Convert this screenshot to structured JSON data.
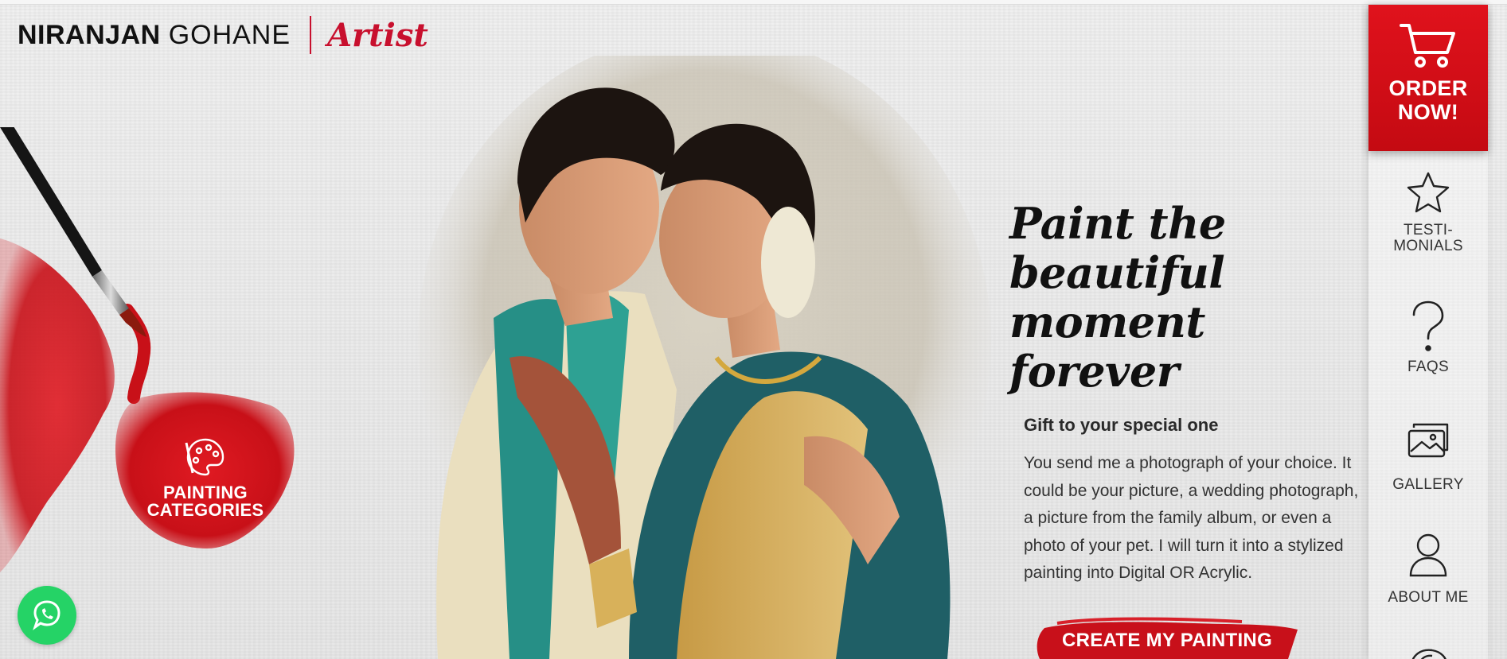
{
  "brand": {
    "first_name": "NIRANJAN",
    "last_name": "GOHANE",
    "tagline": "Artist",
    "accent_color": "#c8102e"
  },
  "categories_cta": {
    "label_line1": "PAINTING",
    "label_line2": "CATEGORIES",
    "icon": "palette-icon"
  },
  "hero": {
    "title_line1": "Paint the",
    "title_line2": "beautiful moment",
    "title_line3": "forever",
    "subtitle": "Gift to your special one",
    "body": "You send me a photograph of your choice. It could be your picture, a wedding photograph, a picture from the family album, or even a photo of your pet. I will turn it into a stylized painting into Digital OR Acrylic.",
    "cta_label": "CREATE MY PAINTING"
  },
  "sidebar": {
    "order": {
      "line1": "ORDER",
      "line2": "NOW!",
      "icon": "cart-icon",
      "color": "#d40f18"
    },
    "items": [
      {
        "line1": "TESTI-",
        "line2": "MONIALS",
        "icon": "star-icon"
      },
      {
        "line1": "FAQS",
        "icon": "question-icon"
      },
      {
        "line1": "GALLERY",
        "icon": "gallery-icon"
      },
      {
        "line1": "ABOUT ME",
        "icon": "user-icon"
      }
    ]
  },
  "whatsapp": {
    "icon": "whatsapp-icon",
    "color": "#25d366"
  }
}
